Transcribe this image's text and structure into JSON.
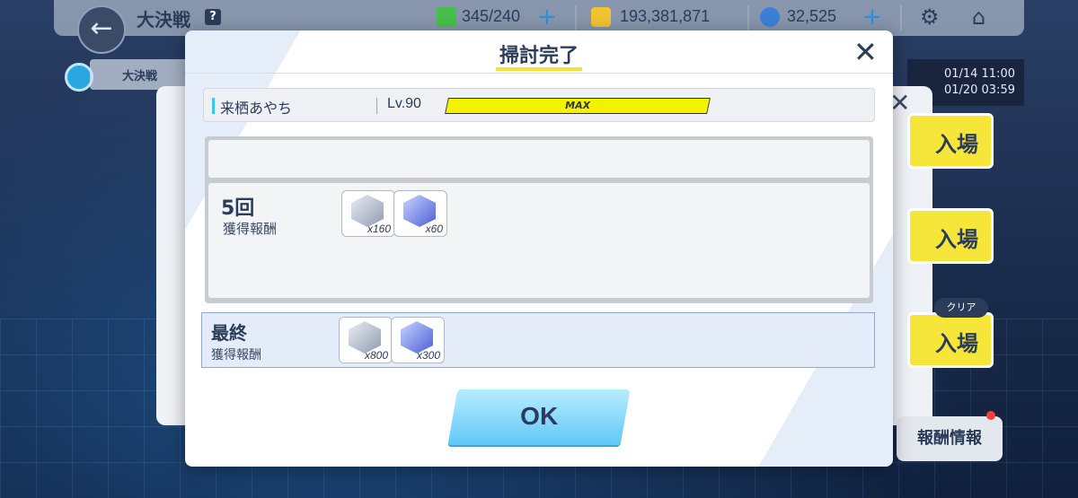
{
  "header": {
    "title": "大決戦",
    "help_label": "?",
    "stamina": "345/240",
    "coins": "193,381,871",
    "gems": "32,525",
    "plus_label": "+"
  },
  "background": {
    "sub_tab": "大決戦",
    "dates": [
      "01/14 11:00",
      "01/20 03:59"
    ],
    "enter_label": "入場",
    "clear_label": "クリア",
    "reward_info": "報酬情報"
  },
  "modal": {
    "title": "掃討完了",
    "character": {
      "name": "来栖あやち",
      "level": "Lv.90",
      "xp_label": "MAX",
      "xp_fraction": 1.0
    },
    "round": {
      "count": "5回",
      "label": "獲得報酬",
      "rewards": [
        {
          "item": "silver-crystal",
          "qty": "x160"
        },
        {
          "item": "blue-crystal",
          "qty": "x60"
        }
      ]
    },
    "final": {
      "title": "最終",
      "label": "獲得報酬",
      "rewards": [
        {
          "item": "silver-crystal",
          "qty": "x800"
        },
        {
          "item": "blue-crystal",
          "qty": "x300"
        }
      ]
    },
    "ok_label": "OK"
  },
  "colors": {
    "accent_yellow": "#f1e23a",
    "ok_blue": "#61c8f7",
    "text_dark": "#2b3c5a"
  }
}
